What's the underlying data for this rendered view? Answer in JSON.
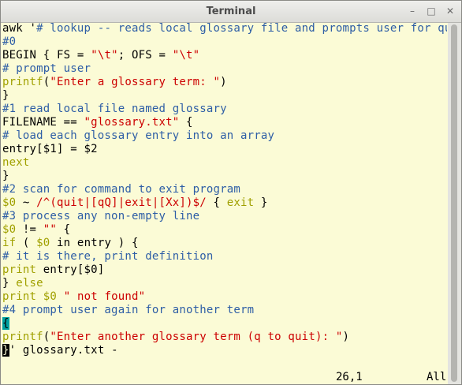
{
  "window": {
    "title": "Terminal"
  },
  "controls": {
    "minimize": "–",
    "maximize": "□",
    "close": "✕"
  },
  "icons": {
    "minimize": "minimize-icon",
    "maximize": "maximize-icon",
    "close": "close-icon"
  },
  "colors": {
    "background": "#fbfbd6",
    "comment": "#2e5ea6",
    "string": "#cc0000",
    "keyword": "#a0a000",
    "cursor": "#00a0a0"
  },
  "lines": [
    [
      {
        "t": "awk '"
      },
      {
        "t": "# lookup -- reads local glossary file and prompts user for query",
        "c": "c"
      }
    ],
    [
      {
        "t": "#0",
        "c": "c"
      }
    ],
    [
      {
        "t": "BEGIN { FS = "
      },
      {
        "t": "\"\\t\"",
        "c": "s"
      },
      {
        "t": "; OFS = "
      },
      {
        "t": "\"\\t\"",
        "c": "s"
      }
    ],
    [
      {
        "t": "# prompt user",
        "c": "c"
      }
    ],
    [
      {
        "t": "printf",
        "c": "k"
      },
      {
        "t": "("
      },
      {
        "t": "\"Enter a glossary term: \"",
        "c": "s"
      },
      {
        "t": ")"
      }
    ],
    [
      {
        "t": "}"
      }
    ],
    [
      {
        "t": "#1 read local file named glossary",
        "c": "c"
      }
    ],
    [
      {
        "t": "FILENAME == "
      },
      {
        "t": "\"glossary.txt\"",
        "c": "s"
      },
      {
        "t": " {"
      }
    ],
    [
      {
        "t": "# load each glossary entry into an array",
        "c": "c"
      }
    ],
    [
      {
        "t": "entry[$1] = $2"
      }
    ],
    [
      {
        "t": "next",
        "c": "k"
      }
    ],
    [
      {
        "t": "}"
      }
    ],
    [
      {
        "t": "#2 scan for command to exit program",
        "c": "c"
      }
    ],
    [
      {
        "t": "$0",
        "c": "k"
      },
      {
        "t": " ~ "
      },
      {
        "t": "/^(quit|[qQ]|exit|[Xx])$/",
        "c": "s"
      },
      {
        "t": " { "
      },
      {
        "t": "exit",
        "c": "k"
      },
      {
        "t": " }"
      }
    ],
    [
      {
        "t": "#3 process any non-empty line",
        "c": "c"
      }
    ],
    [
      {
        "t": "$0",
        "c": "k"
      },
      {
        "t": " != "
      },
      {
        "t": "\"\"",
        "c": "s"
      },
      {
        "t": " {"
      }
    ],
    [
      {
        "t": "if",
        "c": "k"
      },
      {
        "t": " ( "
      },
      {
        "t": "$0",
        "c": "k"
      },
      {
        "t": " in entry ) {"
      }
    ],
    [
      {
        "t": "# it is there, print definition",
        "c": "c"
      }
    ],
    [
      {
        "t": "print",
        "c": "k"
      },
      {
        "t": " entry[$0]"
      }
    ],
    [
      {
        "t": "} "
      },
      {
        "t": "else",
        "c": "k"
      }
    ],
    [
      {
        "t": "print",
        "c": "k"
      },
      {
        "t": " "
      },
      {
        "t": "$0",
        "c": "k"
      },
      {
        "t": " "
      },
      {
        "t": "\" not found\"",
        "c": "s"
      }
    ],
    [
      {
        "t": "#4 prompt user again for another term",
        "c": "c"
      }
    ],
    [
      {
        "t": "{",
        "c": "cur-teal"
      }
    ],
    [
      {
        "t": "printf",
        "c": "k"
      },
      {
        "t": "("
      },
      {
        "t": "\"Enter another glossary term (q to quit): \"",
        "c": "s"
      },
      {
        "t": ")"
      }
    ],
    [
      {
        "t": "}",
        "c": "cur-black"
      },
      {
        "t": "' glossary.txt -"
      }
    ]
  ],
  "status": {
    "position": "26,1",
    "scroll": "All"
  }
}
